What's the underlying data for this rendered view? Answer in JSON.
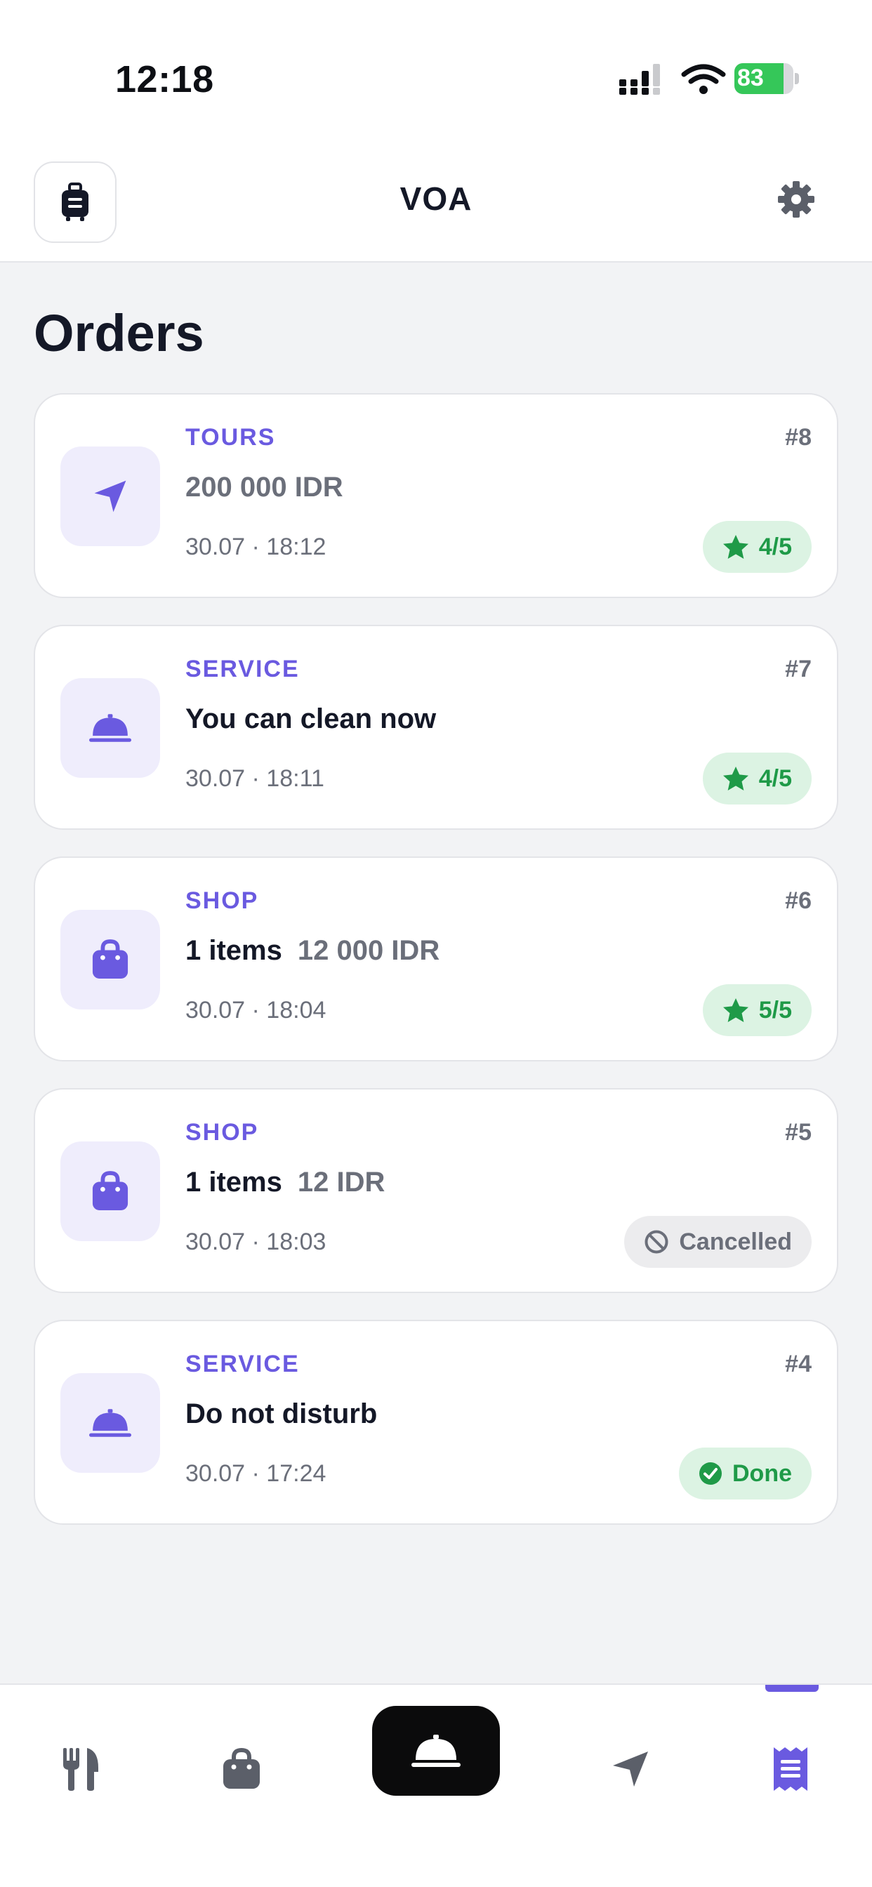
{
  "status_bar": {
    "time": "12:18",
    "battery": "83",
    "battery_level": 0.83
  },
  "header": {
    "title": "VOA",
    "left_icon": "luggage-icon",
    "right_icon": "gear-icon"
  },
  "page": {
    "title": "Orders"
  },
  "orders": [
    {
      "category": "TOURS",
      "number": "#8",
      "title": "200 000 IDR",
      "title_muted": true,
      "items": "",
      "amount": "",
      "time": "30.07 · 18:12",
      "icon": "navigation-arrow-icon",
      "badge_type": "rating",
      "badge_text": "4/5"
    },
    {
      "category": "SERVICE",
      "number": "#7",
      "title": "You can clean now",
      "title_muted": false,
      "items": "",
      "amount": "",
      "time": "30.07 · 18:11",
      "icon": "service-bell-icon",
      "badge_type": "rating",
      "badge_text": "4/5"
    },
    {
      "category": "SHOP",
      "number": "#6",
      "title": "",
      "title_muted": false,
      "items": "1 items",
      "amount": "12 000 IDR",
      "time": "30.07 · 18:04",
      "icon": "shopping-bag-icon",
      "badge_type": "rating",
      "badge_text": "5/5"
    },
    {
      "category": "SHOP",
      "number": "#5",
      "title": "",
      "title_muted": false,
      "items": "1 items",
      "amount": "12 IDR",
      "time": "30.07 · 18:03",
      "icon": "shopping-bag-icon",
      "badge_type": "cancelled",
      "badge_text": "Cancelled"
    },
    {
      "category": "SERVICE",
      "number": "#4",
      "title": "Do not disturb",
      "title_muted": false,
      "items": "",
      "amount": "",
      "time": "30.07 · 17:24",
      "icon": "service-bell-icon",
      "badge_type": "done",
      "badge_text": "Done"
    }
  ],
  "bottom_nav": [
    {
      "name": "restaurant",
      "icon": "fork-knife-icon",
      "active": false
    },
    {
      "name": "shop",
      "icon": "shopping-bag-icon",
      "active": false
    },
    {
      "name": "service",
      "icon": "service-bell-icon",
      "active": false,
      "highlighted": true
    },
    {
      "name": "tours",
      "icon": "navigation-arrow-icon",
      "active": false
    },
    {
      "name": "orders",
      "icon": "receipt-icon",
      "active": true
    }
  ],
  "colors": {
    "accent": "#6a5ae0",
    "success": "#1f9a48",
    "success_bg": "#dcf3e3",
    "muted": "#6b6f7a",
    "icon_bg": "#efedfc"
  }
}
